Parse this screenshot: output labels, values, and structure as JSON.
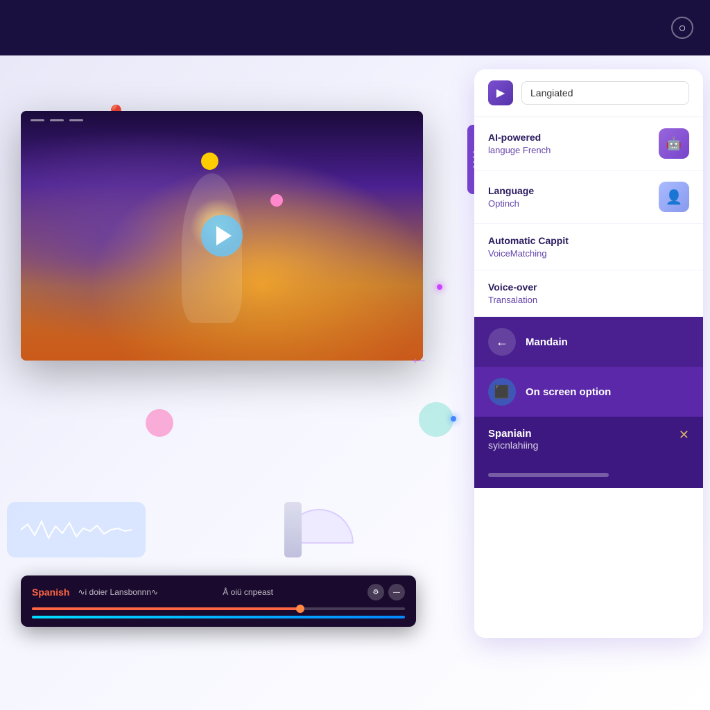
{
  "topbar": {
    "icon_label": "○"
  },
  "panel": {
    "logo_icon": "▶",
    "search_placeholder": "Langiated",
    "search_value": "Langiated",
    "items": [
      {
        "title": "AI-powered",
        "subtitle": "languge French",
        "has_icon": true
      },
      {
        "title": "Language",
        "subtitle": "Optinch",
        "has_icon": true
      },
      {
        "title": "Automatic Cappit",
        "subtitle": "VoiceMatching",
        "has_icon": false
      },
      {
        "title": "Voice-over",
        "subtitle": "Transalation",
        "has_icon": false
      }
    ],
    "mandain_label": "Mandain",
    "onscreen_label": "On screen option",
    "spanish_label": "Spaniain",
    "spanish_sub": "syicnlahiing",
    "footer_bar": ""
  },
  "player": {
    "language": "Spanish",
    "text1": "∿i doier Lansbonnn∿",
    "text2": "Å oiü cnpeast",
    "icon1": "⚙",
    "icon2": "—"
  },
  "icons": {
    "play": "▶",
    "arrow_left": "←",
    "arrow_right": "→",
    "cross": "✕",
    "wrench": "🔧",
    "screen": "⬜",
    "sync": "↻",
    "pin": "📍"
  }
}
